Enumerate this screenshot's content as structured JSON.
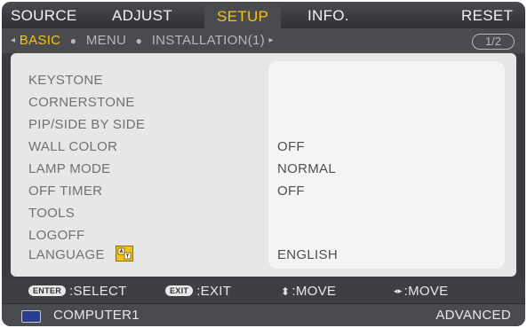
{
  "tabs": [
    "SOURCE",
    "ADJUST",
    "SETUP",
    "INFO.",
    "RESET"
  ],
  "active_tab": "SETUP",
  "subnav": {
    "left_arrow": "◂",
    "items": [
      "BASIC",
      "MENU",
      "INSTALLATION(1)"
    ],
    "current": "BASIC",
    "separator": "●",
    "right_arrow": "▸",
    "page_indicator": "1/2"
  },
  "settings": [
    {
      "label": "KEYSTONE",
      "value": ""
    },
    {
      "label": "CORNERSTONE",
      "value": ""
    },
    {
      "label": "PIP/SIDE BY SIDE",
      "value": ""
    },
    {
      "label": "WALL COLOR",
      "value": "OFF"
    },
    {
      "label": "LAMP MODE",
      "value": "NORMAL"
    },
    {
      "label": "OFF TIMER",
      "value": "OFF"
    },
    {
      "label": "TOOLS",
      "value": ""
    },
    {
      "label": "LOGOFF",
      "value": ""
    },
    {
      "label": "LANGUAGE",
      "value": "ENGLISH",
      "icon": "language-icon"
    }
  ],
  "hints": {
    "enter_key": "ENTER",
    "enter_text": ":SELECT",
    "exit_key": "EXIT",
    "exit_text": ":EXIT",
    "vertical_symbol": "⬍",
    "vertical_text": ":MOVE",
    "horizontal_symbol": "◂▸",
    "horizontal_text": ":MOVE"
  },
  "status": {
    "source_icon": "computer-source-icon",
    "source": "COMPUTER1",
    "level": "ADVANCED"
  },
  "colors": {
    "accent": "#f3c21a",
    "frame": "#3b3c3f",
    "content_bg": "#e7e7e8",
    "value_panel": "#f4f4f4",
    "label_text": "#707175"
  }
}
